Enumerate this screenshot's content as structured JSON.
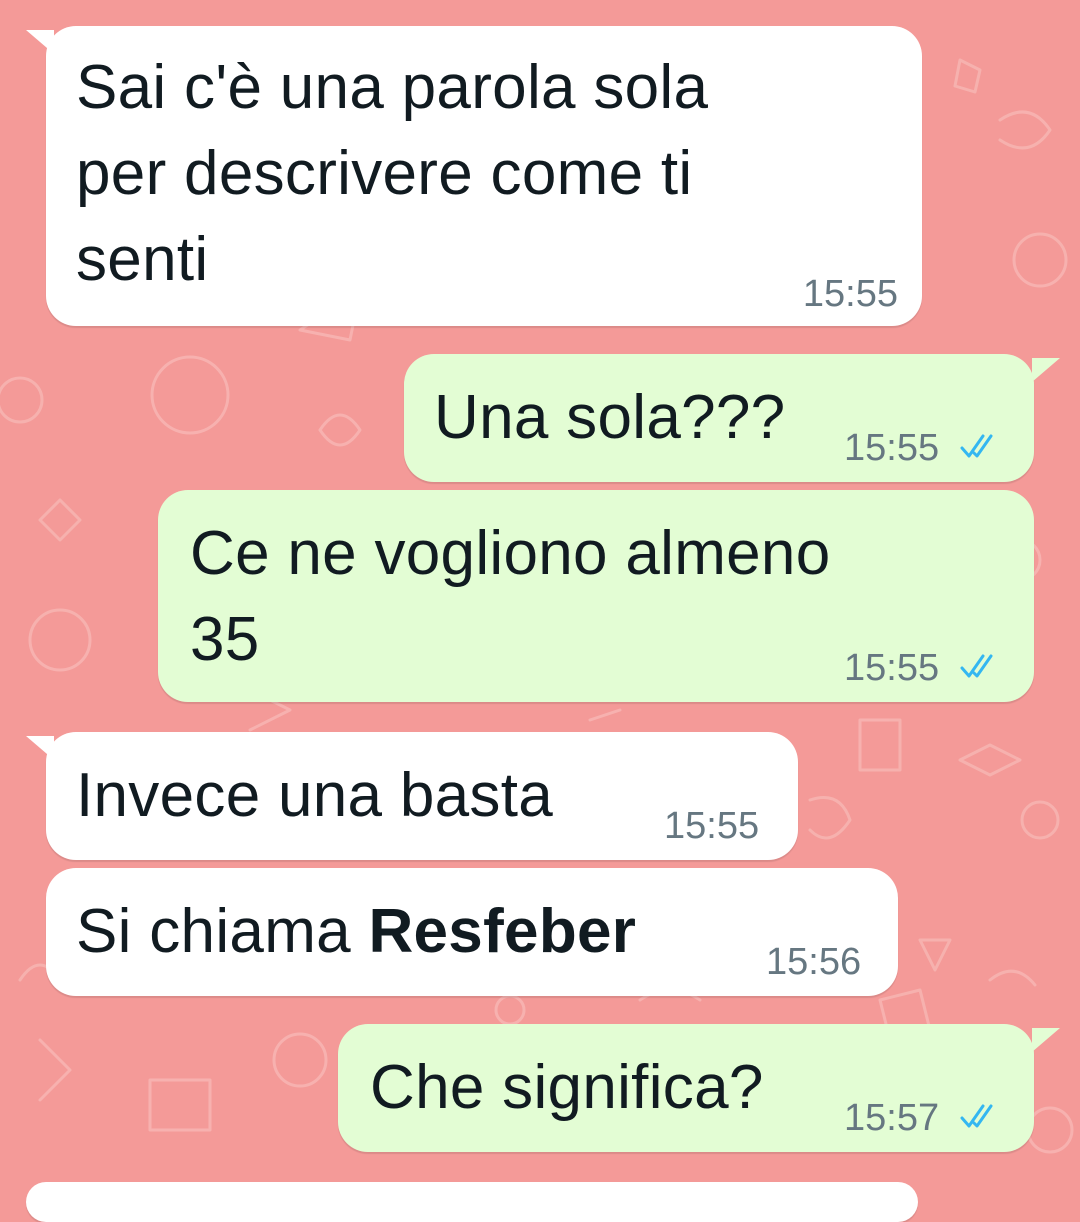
{
  "theme": {
    "wallpaper": "#f49a98",
    "incoming_bubble": "#ffffff",
    "outgoing_bubble": "#e3fdd4",
    "read_tick_color": "#34b7f1"
  },
  "messages": [
    {
      "direction": "incoming",
      "lines": [
        "Sai c'è una parola sola",
        "per descrivere come ti",
        "senti"
      ],
      "time": "15:55"
    },
    {
      "direction": "outgoing",
      "text": "Una sola???",
      "time": "15:55",
      "status": "read-double-check-icon"
    },
    {
      "direction": "outgoing",
      "lines": [
        "Ce ne vogliono almeno",
        "35"
      ],
      "time": "15:55",
      "status": "read-double-check-icon"
    },
    {
      "direction": "incoming",
      "text": "Invece una basta",
      "time": "15:55"
    },
    {
      "direction": "incoming",
      "text_prefix": "Si chiama ",
      "text_bold": "Resfeber",
      "time": "15:56"
    },
    {
      "direction": "outgoing",
      "text": "Che significa?",
      "time": "15:57",
      "status": "read-double-check-icon"
    }
  ]
}
